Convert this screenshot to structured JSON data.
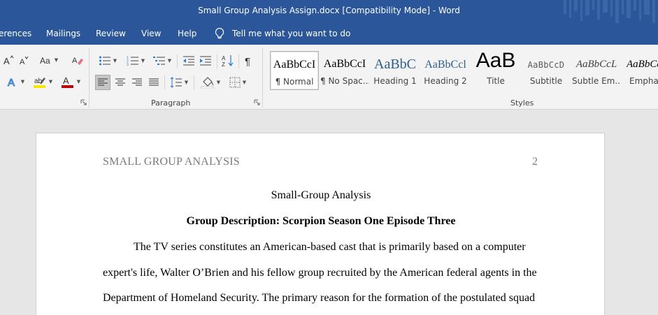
{
  "window": {
    "title": "Small Group Analysis Assign.docx [Compatibility Mode]  -  Word"
  },
  "menu": {
    "tabs": [
      "erences",
      "Mailings",
      "Review",
      "View",
      "Help"
    ],
    "tell_me": "Tell me what you want to do"
  },
  "ribbon": {
    "paragraph_label": "Paragraph",
    "styles_label": "Styles",
    "styles": [
      {
        "sample": "AaBbCcI",
        "label": "¶ Normal",
        "selected": true
      },
      {
        "sample": "AaBbCcI",
        "label": "¶ No Spac..."
      },
      {
        "sample": "AaBbC",
        "label": "Heading 1"
      },
      {
        "sample": "AaBbCcl",
        "label": "Heading 2"
      },
      {
        "sample": "AaB",
        "label": "Title"
      },
      {
        "sample": "AaBbCcD",
        "label": "Subtitle"
      },
      {
        "sample": "AaBbCcL",
        "label": "Subtle Em..."
      },
      {
        "sample": "AaBbCc",
        "label": "Emphas"
      }
    ],
    "colors": {
      "highlight": "#f7e600",
      "font_color": "#c00000",
      "accent": "#2b579a"
    }
  },
  "document": {
    "header_left": "SMALL GROUP ANALYSIS",
    "page_number": "2",
    "heading": "Small-Group Analysis",
    "subheading": "Group Description: Scorpion Season One Episode Three",
    "lines": [
      "The TV series constitutes an American-based cast that is primarily based on a computer",
      "expert's life, Walter O’Brien and his fellow group recruited by the American federal agents in the",
      "Department of Homeland Security. The primary reason for the formation of the postulated squad"
    ]
  }
}
